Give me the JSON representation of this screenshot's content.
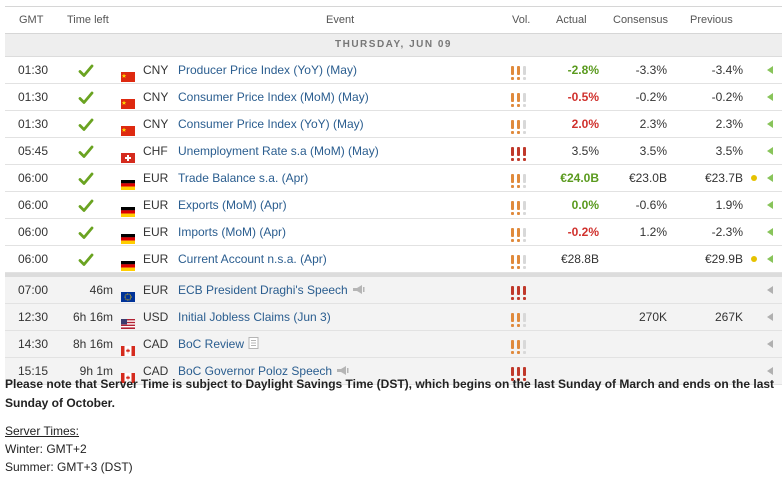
{
  "header": {
    "gmt": "GMT",
    "time_left": "Time left",
    "event": "Event",
    "vol": "Vol.",
    "actual": "Actual",
    "consensus": "Consensus",
    "previous": "Previous"
  },
  "day_label": "THURSDAY, JUN 09",
  "colors": {
    "positive": "#5a9a1e",
    "negative": "#d0312d",
    "vol_high": "#c0392b",
    "vol_med": "#e08a3c",
    "link": "#2a5d8f",
    "revised_dot": "#e6c200"
  },
  "rows": [
    {
      "time": "01:30",
      "left": "",
      "done": true,
      "flag": "cn",
      "currency": "CNY",
      "event": "Producer Price Index (YoY) (May)",
      "icon": "",
      "vol": 2,
      "actual": "-2.8%",
      "actual_tone": "green",
      "consensus": "-3.3%",
      "previous": "-3.4%",
      "revised": false
    },
    {
      "time": "01:30",
      "left": "",
      "done": true,
      "flag": "cn",
      "currency": "CNY",
      "event": "Consumer Price Index (MoM) (May)",
      "icon": "",
      "vol": 2,
      "actual": "-0.5%",
      "actual_tone": "red",
      "consensus": "-0.2%",
      "previous": "-0.2%",
      "revised": false
    },
    {
      "time": "01:30",
      "left": "",
      "done": true,
      "flag": "cn",
      "currency": "CNY",
      "event": "Consumer Price Index (YoY) (May)",
      "icon": "",
      "vol": 2,
      "actual": "2.0%",
      "actual_tone": "red",
      "consensus": "2.3%",
      "previous": "2.3%",
      "revised": false
    },
    {
      "time": "05:45",
      "left": "",
      "done": true,
      "flag": "ch",
      "currency": "CHF",
      "event": "Unemployment Rate s.a (MoM) (May)",
      "icon": "",
      "vol": 3,
      "actual": "3.5%",
      "actual_tone": "neutral",
      "consensus": "3.5%",
      "previous": "3.5%",
      "revised": false
    },
    {
      "time": "06:00",
      "left": "",
      "done": true,
      "flag": "de",
      "currency": "EUR",
      "event": "Trade Balance s.a. (Apr)",
      "icon": "",
      "vol": 2,
      "actual": "€24.0B",
      "actual_tone": "green",
      "consensus": "€23.0B",
      "previous": "€23.7B",
      "revised": true
    },
    {
      "time": "06:00",
      "left": "",
      "done": true,
      "flag": "de",
      "currency": "EUR",
      "event": "Exports (MoM) (Apr)",
      "icon": "",
      "vol": 2,
      "actual": "0.0%",
      "actual_tone": "green",
      "consensus": "-0.6%",
      "previous": "1.9%",
      "revised": false
    },
    {
      "time": "06:00",
      "left": "",
      "done": true,
      "flag": "de",
      "currency": "EUR",
      "event": "Imports (MoM) (Apr)",
      "icon": "",
      "vol": 2,
      "actual": "-0.2%",
      "actual_tone": "red",
      "consensus": "1.2%",
      "previous": "-2.3%",
      "revised": false
    },
    {
      "time": "06:00",
      "left": "",
      "done": true,
      "flag": "de",
      "currency": "EUR",
      "event": "Current Account n.s.a. (Apr)",
      "icon": "",
      "vol": 2,
      "actual": "€28.8B",
      "actual_tone": "neutral",
      "consensus": "",
      "previous": "€29.9B",
      "revised": true
    },
    {
      "time": "07:00",
      "left": "46m",
      "done": false,
      "flag": "eu",
      "currency": "EUR",
      "event": "ECB President Draghi's Speech",
      "icon": "speaker-icon",
      "vol": 3,
      "actual": "",
      "actual_tone": "neutral",
      "consensus": "",
      "previous": "",
      "revised": false
    },
    {
      "time": "12:30",
      "left": "6h 16m",
      "done": false,
      "flag": "us",
      "currency": "USD",
      "event": "Initial Jobless Claims (Jun 3)",
      "icon": "",
      "vol": 2,
      "actual": "",
      "actual_tone": "neutral",
      "consensus": "270K",
      "previous": "267K",
      "revised": false
    },
    {
      "time": "14:30",
      "left": "8h 16m",
      "done": false,
      "flag": "ca",
      "currency": "CAD",
      "event": "BoC Review",
      "icon": "document-icon",
      "vol": 2,
      "actual": "",
      "actual_tone": "neutral",
      "consensus": "",
      "previous": "",
      "revised": false
    },
    {
      "time": "15:15",
      "left": "9h 1m",
      "done": false,
      "flag": "ca",
      "currency": "CAD",
      "event": "BoC Governor Poloz Speech",
      "icon": "speaker-icon",
      "vol": 3,
      "actual": "",
      "actual_tone": "neutral",
      "consensus": "",
      "previous": "",
      "revised": false
    }
  ],
  "note": "Please note that Server Time is subject to Daylight Savings Time (DST), which begins on the last Sunday of March and ends on the last Sunday of October.",
  "server_times": {
    "label": "Server Times:",
    "winter": "Winter: GMT+2",
    "summer": "Summer: GMT+3 (DST)"
  }
}
